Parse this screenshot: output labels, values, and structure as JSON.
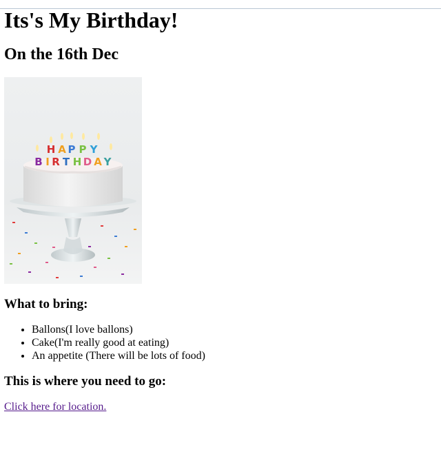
{
  "page": {
    "title": "Its's My Birthday!",
    "subtitle": "On the 16th Dec",
    "image": {
      "candle_text_top": "HAPPY",
      "candle_text_bottom": "BIRTHDAY"
    },
    "bring_heading": "What to bring:",
    "bring_items": [
      "Ballons(I love ballons)",
      "Cake(I'm really good at eating)",
      "An appetite (There will be lots of food)"
    ],
    "go_heading": "This is where you need to go:",
    "location_link": "Click here for location."
  },
  "colors": {
    "link_visited": "#551a8b",
    "text": "#000000",
    "background": "#ffffff"
  }
}
